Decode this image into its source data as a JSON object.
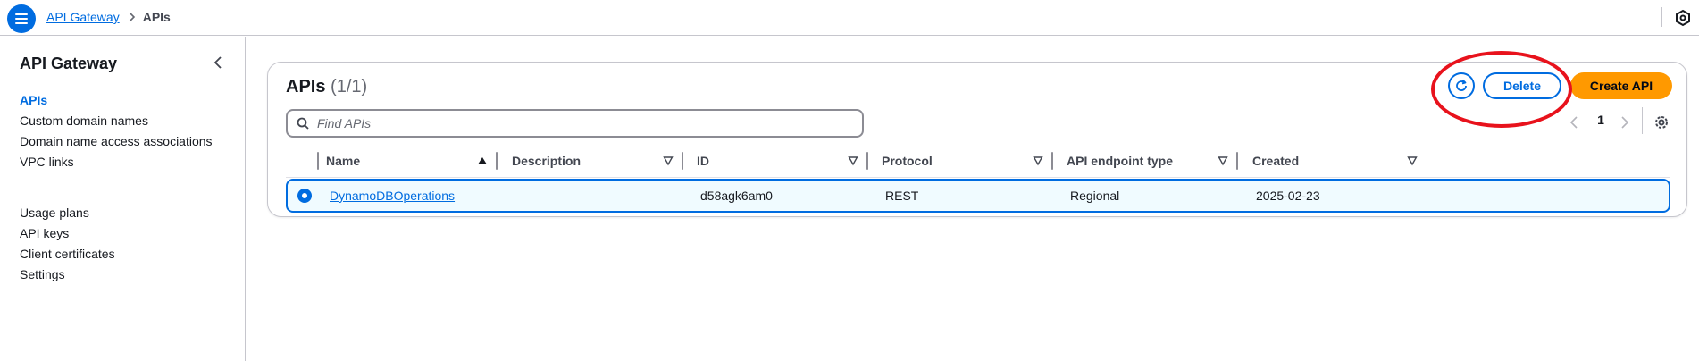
{
  "header": {
    "menu_icon": "hamburger-menu-icon",
    "breadcrumb": {
      "root": "API Gateway",
      "current": "APIs"
    },
    "settings_icon": "settings-hexagon-icon"
  },
  "sidebar": {
    "title": "API Gateway",
    "collapse_icon": "chevron-left-icon",
    "items": [
      {
        "label": "APIs",
        "active": true
      },
      {
        "label": "Custom domain names"
      },
      {
        "label": "Domain name access associations"
      },
      {
        "label": "VPC links"
      },
      {
        "label": "Usage plans"
      },
      {
        "label": "API keys"
      },
      {
        "label": "Client certificates"
      },
      {
        "label": "Settings"
      }
    ]
  },
  "main": {
    "title": "APIs",
    "count": "(1/1)",
    "actions": {
      "refresh_icon": "refresh-icon",
      "delete": "Delete",
      "create": "Create API"
    },
    "search": {
      "placeholder": "Find APIs",
      "value": ""
    },
    "pagination": {
      "current_page": "1"
    },
    "table": {
      "columns": [
        "Name",
        "Description",
        "ID",
        "Protocol",
        "API endpoint type",
        "Created"
      ],
      "sorted_column": "Name",
      "sort_direction": "ascending",
      "rows": [
        {
          "selected": true,
          "name": "DynamoDBOperations",
          "description": "",
          "id": "d58agk6am0",
          "protocol": "REST",
          "endpoint_type": "Regional",
          "created": "2025-02-23"
        }
      ]
    },
    "annotation_color": "#e8121c"
  },
  "colors": {
    "accent": "#006ce0",
    "primary_button": "#ff9900",
    "annotation": "#e8121c"
  }
}
